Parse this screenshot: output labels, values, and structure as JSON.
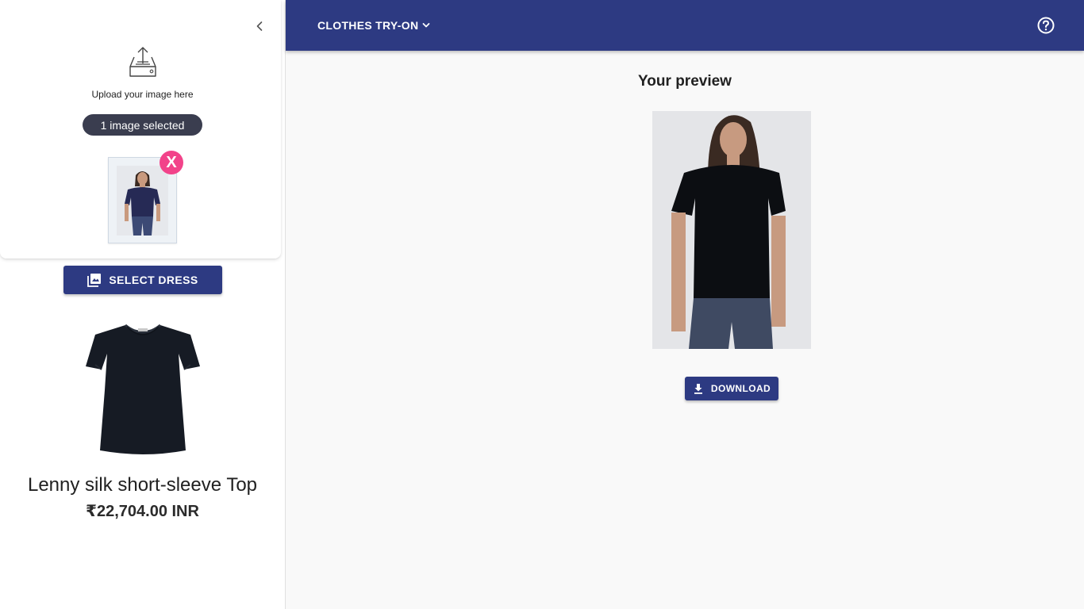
{
  "header": {
    "app_menu_label": "CLOTHES TRY-ON",
    "menu_icon": "chevron-down-icon",
    "help_icon": "help-circle-icon"
  },
  "sidebar": {
    "collapse_icon": "chevron-left-icon",
    "upload": {
      "icon": "upload-tray-icon",
      "prompt": "Upload your image here",
      "selected_status": "1 image selected",
      "remove_label": "X"
    },
    "select_button": {
      "icon": "image-icon",
      "label": "SELECT DRESS"
    },
    "product": {
      "name": "Lenny silk short-sleeve Top",
      "price": "₹22,704.00 INR"
    }
  },
  "main": {
    "preview_title": "Your preview",
    "download_button": {
      "icon": "download-icon",
      "label": "DOWNLOAD"
    }
  },
  "colors": {
    "primary": "#2d3a82",
    "chip": "#3a3d4f",
    "remove": "#f2438a",
    "background": "#f9f9f9"
  }
}
